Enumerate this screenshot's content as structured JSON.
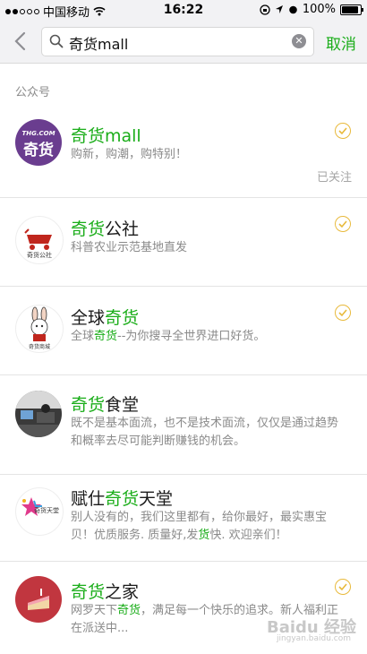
{
  "status_bar": {
    "carrier": "中国移动",
    "time": "16:22",
    "battery": "100%",
    "battery_level": 1.0
  },
  "search": {
    "query": "奇货mall",
    "cancel_label": "取消"
  },
  "section": {
    "label": "公众号"
  },
  "results": [
    {
      "title_hl": "奇货mall",
      "title_rest": "",
      "title_pre": "",
      "desc": "购新，购潮，购特别！",
      "followed": true,
      "followed_label": "已关注",
      "avatar_text": "奇货",
      "avatar_top": "THG.COM"
    },
    {
      "title_pre": "",
      "title_hl": "奇货",
      "title_rest": "公社",
      "desc": "科普农业示范基地直发",
      "followed": true,
      "avatar_text": "奇货公社"
    },
    {
      "title_pre": "全球",
      "title_hl": "奇货",
      "title_rest": "",
      "desc_pre": "全球",
      "desc_hl": "奇货",
      "desc_rest": "--为你搜寻全世界进口好货。",
      "followed": true,
      "avatar_text": "奇货商城"
    },
    {
      "title_pre": "",
      "title_hl": "奇货",
      "title_rest": "食堂",
      "desc": "既不是基本面流，也不是技术面流，仅仅是通过趋势和概率去尽可能判断赚钱的机会。",
      "followed": false
    },
    {
      "title_pre": "赋仕",
      "title_hl": "奇货",
      "title_rest": "天堂",
      "desc_pre": "别人没有的，我们这里都有，给你最好，最实惠宝贝！优质服务. 质量好,发",
      "desc_hl": "货",
      "desc_rest": "快. 欢迎亲们！",
      "followed": false,
      "avatar_text": "奇货天堂"
    },
    {
      "title_pre": "",
      "title_hl": "奇货",
      "title_rest": "之家",
      "desc_pre": "网罗天下",
      "desc_hl": "奇货",
      "desc_rest": "，满足每一个快乐的追求。新人福利正在派送中...",
      "followed": true
    }
  ],
  "watermark": {
    "text": "Baidu 经验",
    "sub": "jingyan.baidu.com"
  },
  "colors": {
    "accent": "#1aad19",
    "check": "#e8b93a"
  }
}
